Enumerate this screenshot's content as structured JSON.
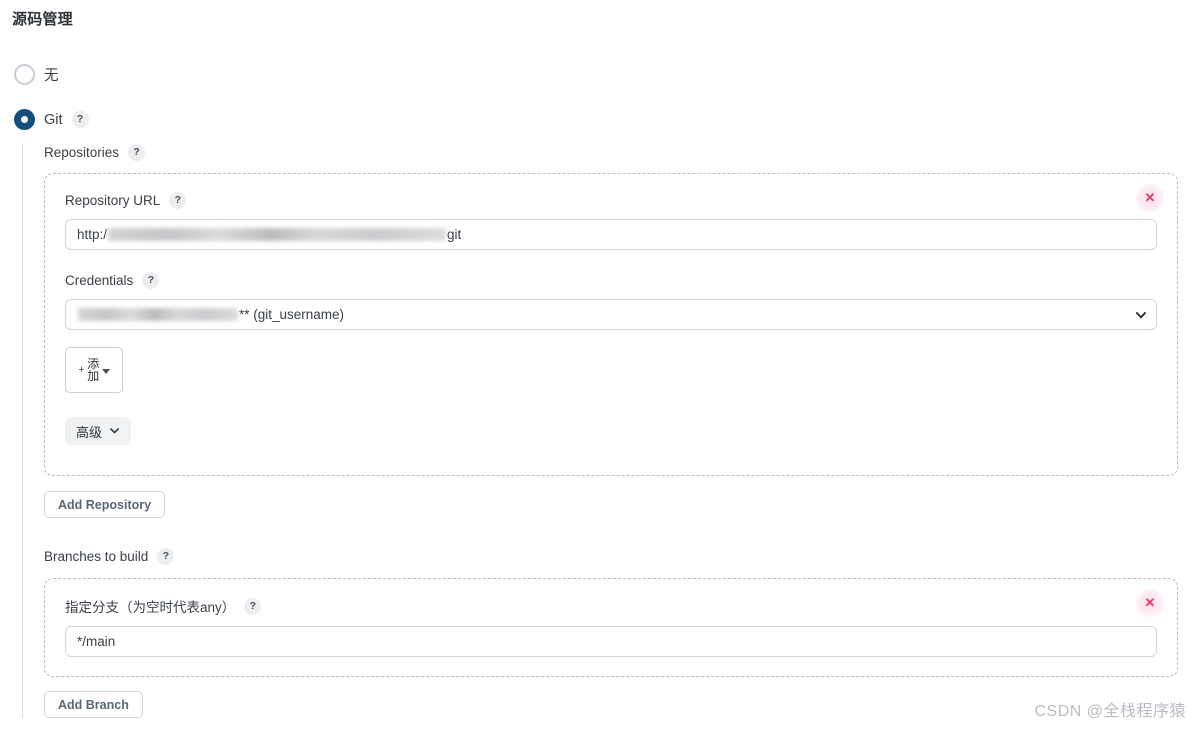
{
  "page": {
    "title": "源码管理",
    "watermark": "CSDN @全栈程序猿"
  },
  "scm_options": [
    {
      "label": "无",
      "selected": false,
      "has_help": false
    },
    {
      "label": "Git",
      "selected": true,
      "has_help": true
    }
  ],
  "help_glyph": "?",
  "git": {
    "repositories_label": "Repositories",
    "repository": {
      "url_label": "Repository URL",
      "url_value_prefix": "http:/",
      "url_value_suffix": "git",
      "url_redacted": true,
      "credentials_label": "Credentials",
      "credentials_value_suffix": "** (git_username)",
      "credentials_redacted": true,
      "add_credential_label": "添加",
      "add_credential_plus": "+",
      "advanced_label": "高级"
    },
    "add_repository_label": "Add Repository",
    "branches_label": "Branches to build",
    "branch": {
      "specifier_label": "指定分支（为空时代表any）",
      "specifier_value": "*/main"
    },
    "add_branch_label": "Add Branch"
  },
  "delete_glyph": "✕",
  "colors": {
    "accent": "#124f7e",
    "delete": "#e8396b",
    "border": "#d3d7dc",
    "dashed_border": "#b9bec5",
    "text": "#3b4148",
    "watermark": "#b9bdc2"
  }
}
